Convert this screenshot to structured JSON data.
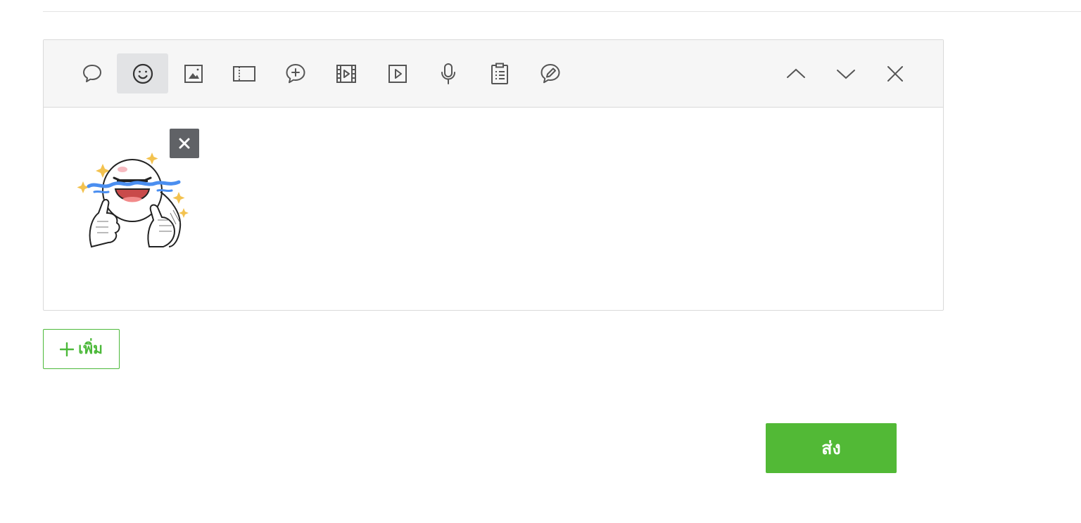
{
  "colors": {
    "accent_green": "#52b936",
    "add_border_green": "#4cb93a",
    "toolbar_bg": "#f6f6f6",
    "active_tool_bg": "#e2e3e5",
    "icon_gray": "#555555",
    "remove_bg": "#606266"
  },
  "toolbar": {
    "tools": [
      {
        "icon": "speech-bubble-icon",
        "active": false
      },
      {
        "icon": "smiley-icon",
        "active": true
      },
      {
        "icon": "image-icon",
        "active": false
      },
      {
        "icon": "coupon-icon",
        "active": false
      },
      {
        "icon": "rich-message-icon",
        "active": false
      },
      {
        "icon": "video-icon",
        "active": false
      },
      {
        "icon": "play-icon",
        "active": false
      },
      {
        "icon": "microphone-icon",
        "active": false
      },
      {
        "icon": "clipboard-icon",
        "active": false
      },
      {
        "icon": "pen-icon",
        "active": false
      }
    ],
    "controls": [
      {
        "icon": "chevron-up-icon"
      },
      {
        "icon": "chevron-down-icon"
      },
      {
        "icon": "close-icon"
      }
    ]
  },
  "content": {
    "sticker": {
      "icon": "sticker-laughing-thumbs-up"
    },
    "remove_icon": "close-x-icon"
  },
  "actions": {
    "add_label": "เพิ่ม",
    "add_icon": "plus-icon",
    "send_label": "ส่ง"
  }
}
